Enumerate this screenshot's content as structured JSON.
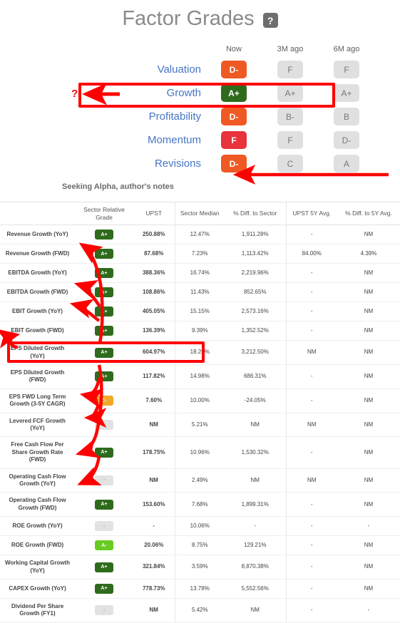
{
  "header": {
    "title": "Factor Grades",
    "help_icon": "question-mark-icon",
    "help_label": "?"
  },
  "factor_grades": {
    "columns": [
      "Now",
      "3M ago",
      "6M ago"
    ],
    "rows": [
      {
        "label": "Valuation",
        "now": "D-",
        "m3": "F",
        "m6": "F",
        "now_color": "#ef5923"
      },
      {
        "label": "Growth",
        "now": "A+",
        "m3": "A+",
        "m6": "A+",
        "now_color": "#2f6b1c"
      },
      {
        "label": "Profitability",
        "now": "D-",
        "m3": "B-",
        "m6": "B",
        "now_color": "#ef5923"
      },
      {
        "label": "Momentum",
        "now": "F",
        "m3": "F",
        "m6": "D-",
        "now_color": "#e8333c"
      },
      {
        "label": "Revisions",
        "now": "D-",
        "m3": "C",
        "m6": "A",
        "now_color": "#ef5923"
      }
    ]
  },
  "caption": "Seeking Alpha, author's notes",
  "annotations": {
    "question_mark": "?",
    "highlight_color": "#ff0000"
  },
  "table": {
    "columns": [
      "",
      "Sector Relative Grade",
      "UPST",
      "Sector Median",
      "% Diff. to Sector",
      "UPST 5Y Avg.",
      "% Diff. to 5Y Avg."
    ],
    "rows": [
      {
        "metric": "Revenue Growth (YoY)",
        "grade": "A+",
        "grade_color": "#2f6b1c",
        "upst": "250.88%",
        "median": "12.47%",
        "diff_sector": "1,911.28%",
        "avg5y": "-",
        "diff_5y": "NM"
      },
      {
        "metric": "Revenue Growth (FWD)",
        "grade": "A+",
        "grade_color": "#2f6b1c",
        "upst": "87.68%",
        "median": "7.23%",
        "diff_sector": "1,113.42%",
        "avg5y": "84.00%",
        "diff_5y": "4.39%"
      },
      {
        "metric": "EBITDA Growth (YoY)",
        "grade": "A+",
        "grade_color": "#2f6b1c",
        "upst": "388.36%",
        "median": "16.74%",
        "diff_sector": "2,219.96%",
        "avg5y": "-",
        "diff_5y": "NM"
      },
      {
        "metric": "EBITDA Growth (FWD)",
        "grade": "A+",
        "grade_color": "#2f6b1c",
        "upst": "108.86%",
        "median": "11.43%",
        "diff_sector": "852.65%",
        "avg5y": "-",
        "diff_5y": "NM"
      },
      {
        "metric": "EBIT Growth (YoY)",
        "grade": "A+",
        "grade_color": "#2f6b1c",
        "upst": "405.05%",
        "median": "15.15%",
        "diff_sector": "2,573.16%",
        "avg5y": "-",
        "diff_5y": "NM"
      },
      {
        "metric": "EBIT Growth (FWD)",
        "grade": "A+",
        "grade_color": "#2f6b1c",
        "upst": "136.39%",
        "median": "9.39%",
        "diff_sector": "1,352.52%",
        "avg5y": "-",
        "diff_5y": "NM"
      },
      {
        "metric": "EPS Diluted Growth (YoY)",
        "grade": "A+",
        "grade_color": "#2f6b1c",
        "upst": "604.97%",
        "median": "18.26%",
        "diff_sector": "3,212.50%",
        "avg5y": "NM",
        "diff_5y": "NM"
      },
      {
        "metric": "EPS Diluted Growth (FWD)",
        "grade": "A+",
        "grade_color": "#2f6b1c",
        "upst": "117.82%",
        "median": "14.98%",
        "diff_sector": "686.31%",
        "avg5y": "-",
        "diff_5y": "NM"
      },
      {
        "metric": "EPS FWD Long Term Growth (3-5Y CAGR)",
        "grade": "C-",
        "grade_color": "#f0a827",
        "upst": "7.60%",
        "median": "10.00%",
        "diff_sector": "-24.05%",
        "avg5y": "-",
        "diff_5y": "NM",
        "highlighted": true
      },
      {
        "metric": "Levered FCF Growth (YoY)",
        "grade": "-",
        "grade_color": "",
        "upst": "NM",
        "median": "5.21%",
        "diff_sector": "NM",
        "avg5y": "NM",
        "diff_5y": "NM"
      },
      {
        "metric": "Free Cash Flow Per Share Growth Rate (FWD)",
        "grade": "A+",
        "grade_color": "#2f6b1c",
        "upst": "178.75%",
        "median": "10.96%",
        "diff_sector": "1,530.32%",
        "avg5y": "-",
        "diff_5y": "NM"
      },
      {
        "metric": "Operating Cash Flow Growth (YoY)",
        "grade": "-",
        "grade_color": "",
        "upst": "NM",
        "median": "2.49%",
        "diff_sector": "NM",
        "avg5y": "NM",
        "diff_5y": "NM"
      },
      {
        "metric": "Operating Cash Flow Growth (FWD)",
        "grade": "A+",
        "grade_color": "#2f6b1c",
        "upst": "153.60%",
        "median": "7.68%",
        "diff_sector": "1,899.31%",
        "avg5y": "-",
        "diff_5y": "NM"
      },
      {
        "metric": "ROE Growth (YoY)",
        "grade": "-",
        "grade_color": "",
        "upst": "-",
        "median": "10.06%",
        "diff_sector": "-",
        "avg5y": "-",
        "diff_5y": "-"
      },
      {
        "metric": "ROE Growth (FWD)",
        "grade": "A-",
        "grade_color": "#66cc22",
        "upst": "20.06%",
        "median": "8.75%",
        "diff_sector": "129.21%",
        "avg5y": "-",
        "diff_5y": "NM"
      },
      {
        "metric": "Working Capital Growth (YoY)",
        "grade": "A+",
        "grade_color": "#2f6b1c",
        "upst": "321.84%",
        "median": "3.59%",
        "diff_sector": "8,870.38%",
        "avg5y": "-",
        "diff_5y": "NM"
      },
      {
        "metric": "CAPEX Growth (YoY)",
        "grade": "A+",
        "grade_color": "#2f6b1c",
        "upst": "778.73%",
        "median": "13.78%",
        "diff_sector": "5,552.56%",
        "avg5y": "-",
        "diff_5y": "NM"
      },
      {
        "metric": "Dividend Per Share Growth (FY1)",
        "grade": "-",
        "grade_color": "",
        "upst": "NM",
        "median": "5.42%",
        "diff_sector": "NM",
        "avg5y": "-",
        "diff_5y": "-"
      }
    ]
  }
}
